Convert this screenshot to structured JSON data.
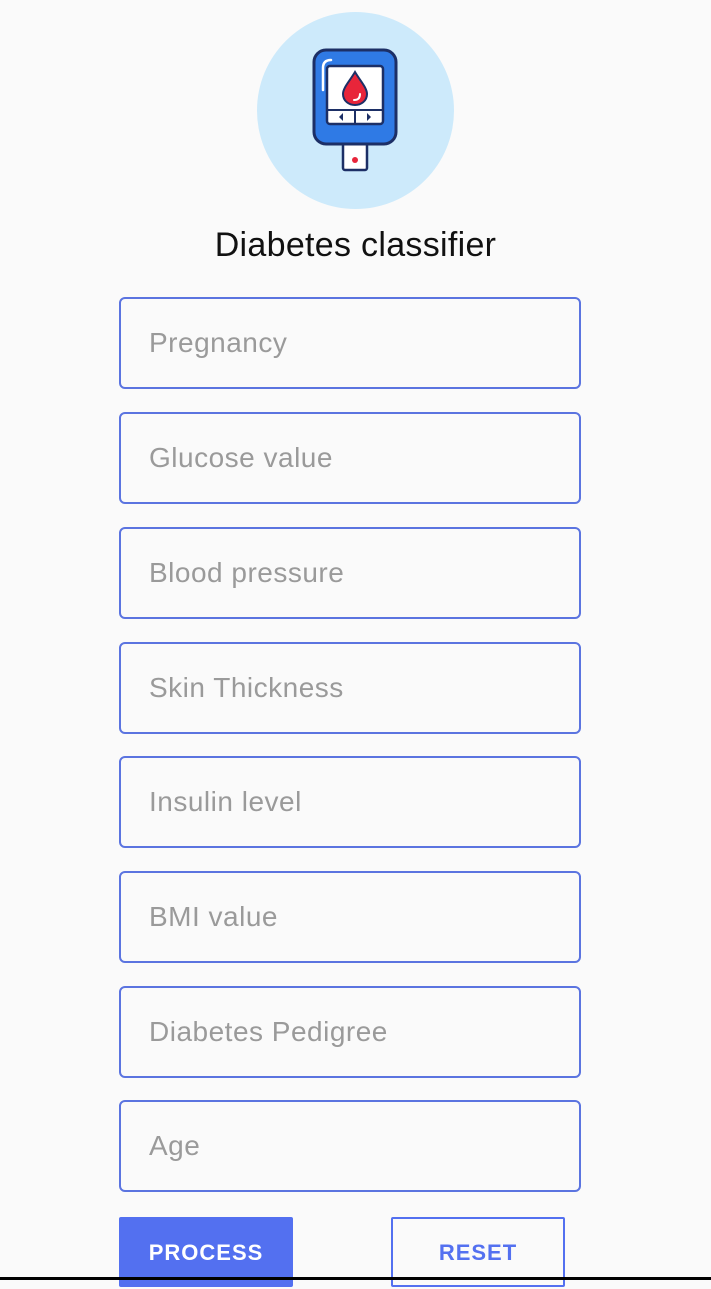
{
  "app": {
    "title": "Diabetes classifier",
    "logo_icon": "glucose-meter-icon",
    "colors": {
      "accent": "#5370f0",
      "field_border": "#5b74e0",
      "logo_bg": "#cdeafb",
      "device_blue": "#2f7ae5",
      "blood_red": "#e8253a"
    }
  },
  "form": {
    "fields": [
      {
        "name": "pregnancy",
        "placeholder": "Pregnancy",
        "value": ""
      },
      {
        "name": "glucose",
        "placeholder": "Glucose value",
        "value": ""
      },
      {
        "name": "blood-pressure",
        "placeholder": "Blood pressure",
        "value": ""
      },
      {
        "name": "skin-thickness",
        "placeholder": "Skin Thickness",
        "value": ""
      },
      {
        "name": "insulin",
        "placeholder": "Insulin level",
        "value": ""
      },
      {
        "name": "bmi",
        "placeholder": "BMI value",
        "value": ""
      },
      {
        "name": "diabetes-pedigree",
        "placeholder": "Diabetes Pedigree",
        "value": ""
      },
      {
        "name": "age",
        "placeholder": "Age",
        "value": ""
      }
    ]
  },
  "buttons": {
    "process_label": "PROCESS",
    "reset_label": "RESET"
  }
}
